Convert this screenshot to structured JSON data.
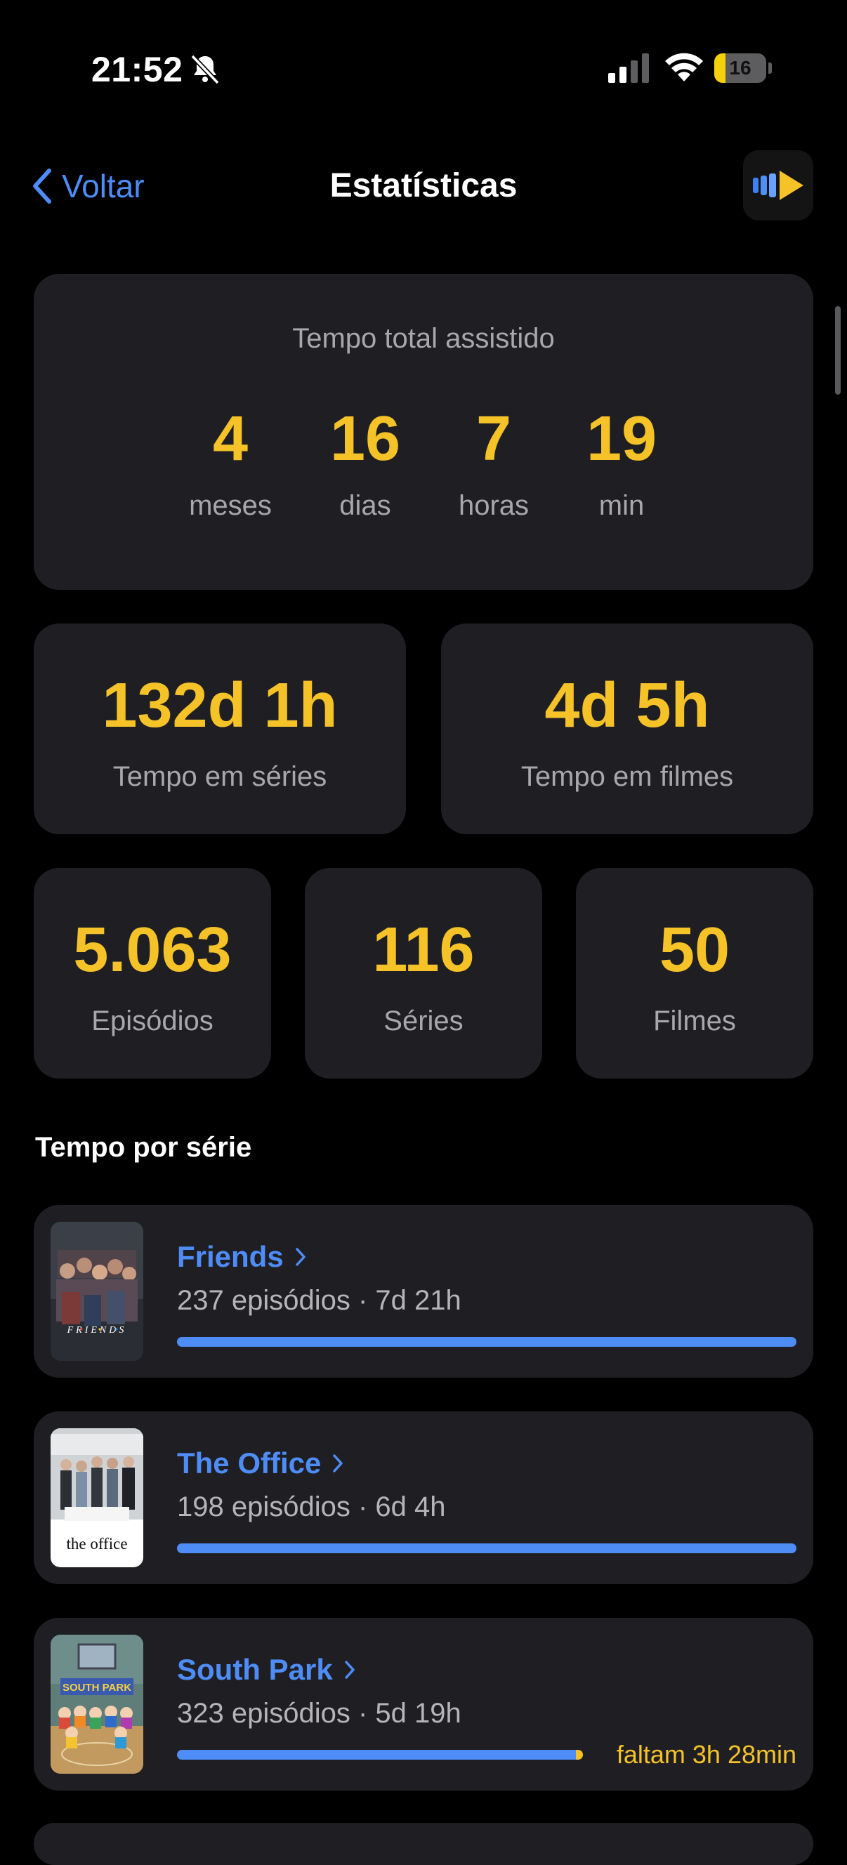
{
  "status_bar": {
    "time": "21:52",
    "battery": "16",
    "battery_percent": 16
  },
  "nav": {
    "back_label": "Voltar",
    "title": "Estatísticas",
    "app_icon": "play-stripes-icon"
  },
  "total_watched": {
    "title": "Tempo total assistido",
    "units": [
      {
        "value": "4",
        "label": "meses"
      },
      {
        "value": "16",
        "label": "dias"
      },
      {
        "value": "7",
        "label": "horas"
      },
      {
        "value": "19",
        "label": "min"
      }
    ]
  },
  "time_split": [
    {
      "value": "132d 1h",
      "label": "Tempo em séries"
    },
    {
      "value": "4d 5h",
      "label": "Tempo em filmes"
    }
  ],
  "counts": [
    {
      "value": "5.063",
      "label": "Episódios"
    },
    {
      "value": "116",
      "label": "Séries"
    },
    {
      "value": "50",
      "label": "Filmes"
    }
  ],
  "section_title": "Tempo por série",
  "series": [
    {
      "title": "Friends",
      "subtitle": "237 episódios · 7d 21h",
      "progress": 1.0,
      "remaining": ""
    },
    {
      "title": "The Office",
      "subtitle": "198 episódios · 6d 4h",
      "progress": 1.0,
      "remaining": ""
    },
    {
      "title": "South Park",
      "subtitle": "323 episódios · 5d 19h",
      "progress": 0.655,
      "remaining": "faltam 3h 28min"
    }
  ],
  "colors": {
    "accent": "#4e8cf7",
    "gold": "#f5c227",
    "card": "#1f1f23",
    "background": "#000000"
  }
}
